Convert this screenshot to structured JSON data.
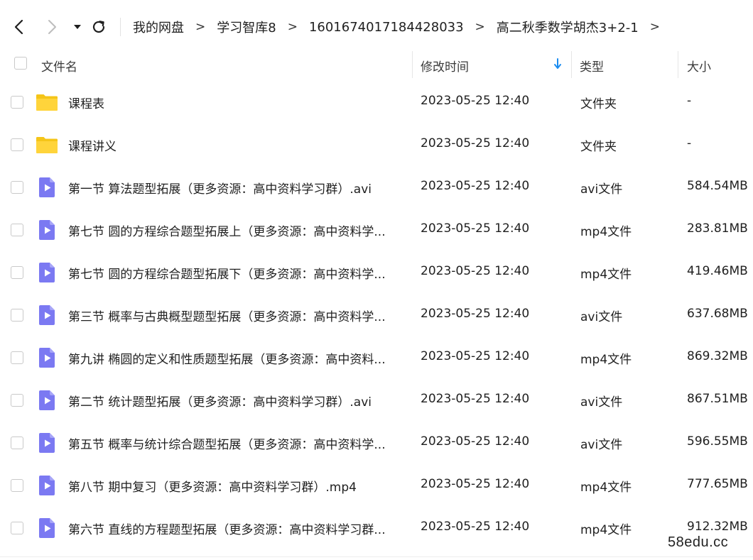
{
  "toolbar": {
    "back_icon": "chevron-left-icon",
    "forward_icon": "chevron-right-icon",
    "dropdown_icon": "caret-down-icon",
    "refresh_icon": "refresh-icon"
  },
  "breadcrumb": {
    "items": [
      "我的网盘",
      "学习智库8",
      "1601674017184428033",
      "高二秋季数学胡杰3+2-1"
    ],
    "separator": ">"
  },
  "header": {
    "name": "文件名",
    "modified": "修改时间",
    "type": "类型",
    "size": "大小",
    "sort_icon": "arrow-down-icon",
    "sort_color": "#1a8cf0"
  },
  "files": [
    {
      "kind": "folder",
      "name": "课程表",
      "date": "2023-05-25 12:40",
      "type": "文件夹",
      "size": "-"
    },
    {
      "kind": "folder",
      "name": "课程讲义",
      "date": "2023-05-25 12:40",
      "type": "文件夹",
      "size": "-"
    },
    {
      "kind": "video",
      "name": "第一节 算法题型拓展（更多资源：高中资料学习群）.avi",
      "date": "2023-05-25 12:40",
      "type": "avi文件",
      "size": "584.54MB"
    },
    {
      "kind": "video",
      "name": "第七节 圆的方程综合题型拓展上（更多资源：高中资料学...",
      "date": "2023-05-25 12:40",
      "type": "mp4文件",
      "size": "283.81MB"
    },
    {
      "kind": "video",
      "name": "第七节 圆的方程综合题型拓展下（更多资源：高中资料学...",
      "date": "2023-05-25 12:40",
      "type": "mp4文件",
      "size": "419.46MB"
    },
    {
      "kind": "video",
      "name": "第三节 概率与古典概型题型拓展（更多资源：高中资料学...",
      "date": "2023-05-25 12:40",
      "type": "avi文件",
      "size": "637.68MB"
    },
    {
      "kind": "video",
      "name": "第九讲 椭圆的定义和性质题型拓展（更多资源：高中资料...",
      "date": "2023-05-25 12:40",
      "type": "mp4文件",
      "size": "869.32MB"
    },
    {
      "kind": "video",
      "name": "第二节 统计题型拓展（更多资源：高中资料学习群）.avi",
      "date": "2023-05-25 12:40",
      "type": "avi文件",
      "size": "867.51MB"
    },
    {
      "kind": "video",
      "name": "第五节 概率与统计综合题型拓展（更多资源：高中资料学...",
      "date": "2023-05-25 12:40",
      "type": "avi文件",
      "size": "596.55MB"
    },
    {
      "kind": "video",
      "name": "第八节 期中复习（更多资源：高中资料学习群）.mp4",
      "date": "2023-05-25 12:40",
      "type": "mp4文件",
      "size": "777.65MB"
    },
    {
      "kind": "video",
      "name": "第六节 直线的方程题型拓展（更多资源：高中资料学习群...",
      "date": "2023-05-25 12:40",
      "type": "mp4文件",
      "size": "912.32MB"
    }
  ],
  "icons": {
    "folder": "folder-icon",
    "video": "video-file-icon",
    "folder_color": "#ffd43b",
    "video_color": "#7b79f2"
  },
  "watermark": "58edu.cc"
}
